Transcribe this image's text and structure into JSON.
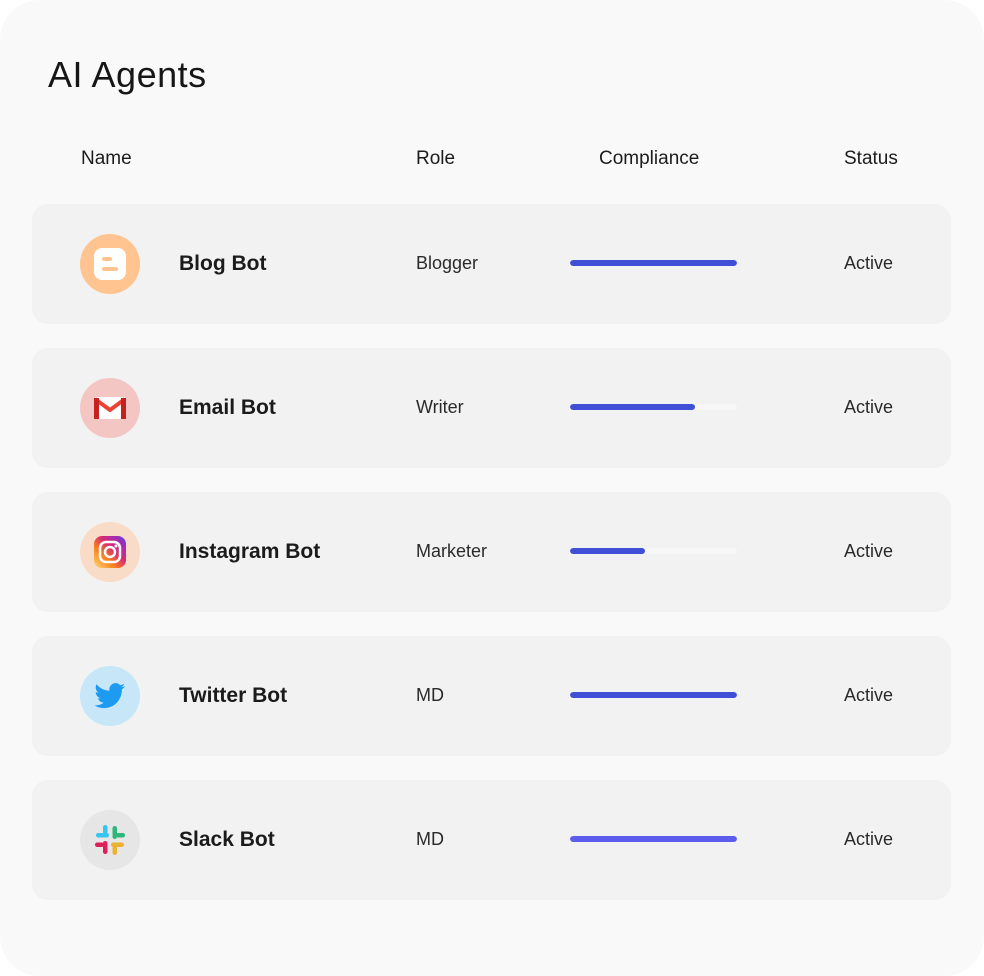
{
  "title": "AI Agents",
  "columns": {
    "name": "Name",
    "role": "Role",
    "compliance": "Compliance",
    "status": "Status"
  },
  "agents": [
    {
      "name": "Blog Bot",
      "role": "Blogger",
      "compliance": 1.0,
      "status": "Active",
      "icon": "blogger-icon",
      "icon_bg": "#ffc48f",
      "bar_color": "#3f4fd8"
    },
    {
      "name": "Email Bot",
      "role": "Writer",
      "compliance": 0.75,
      "status": "Active",
      "icon": "gmail-icon",
      "icon_bg": "#f4c6c3",
      "bar_color": "#3f4fd8"
    },
    {
      "name": "Instagram Bot",
      "role": "Marketer",
      "compliance": 0.45,
      "status": "Active",
      "icon": "instagram-icon",
      "icon_bg": "#f9dcc7",
      "bar_color": "#3f4fd8"
    },
    {
      "name": "Twitter Bot",
      "role": "MD",
      "compliance": 1.0,
      "status": "Active",
      "icon": "twitter-icon",
      "icon_bg": "#c7e7f8",
      "bar_color": "#3f4fd8"
    },
    {
      "name": "Slack Bot",
      "role": "MD",
      "compliance": 1.0,
      "status": "Active",
      "icon": "slack-icon",
      "icon_bg": "#e6e6e6",
      "bar_color": "#5c5cef"
    }
  ]
}
